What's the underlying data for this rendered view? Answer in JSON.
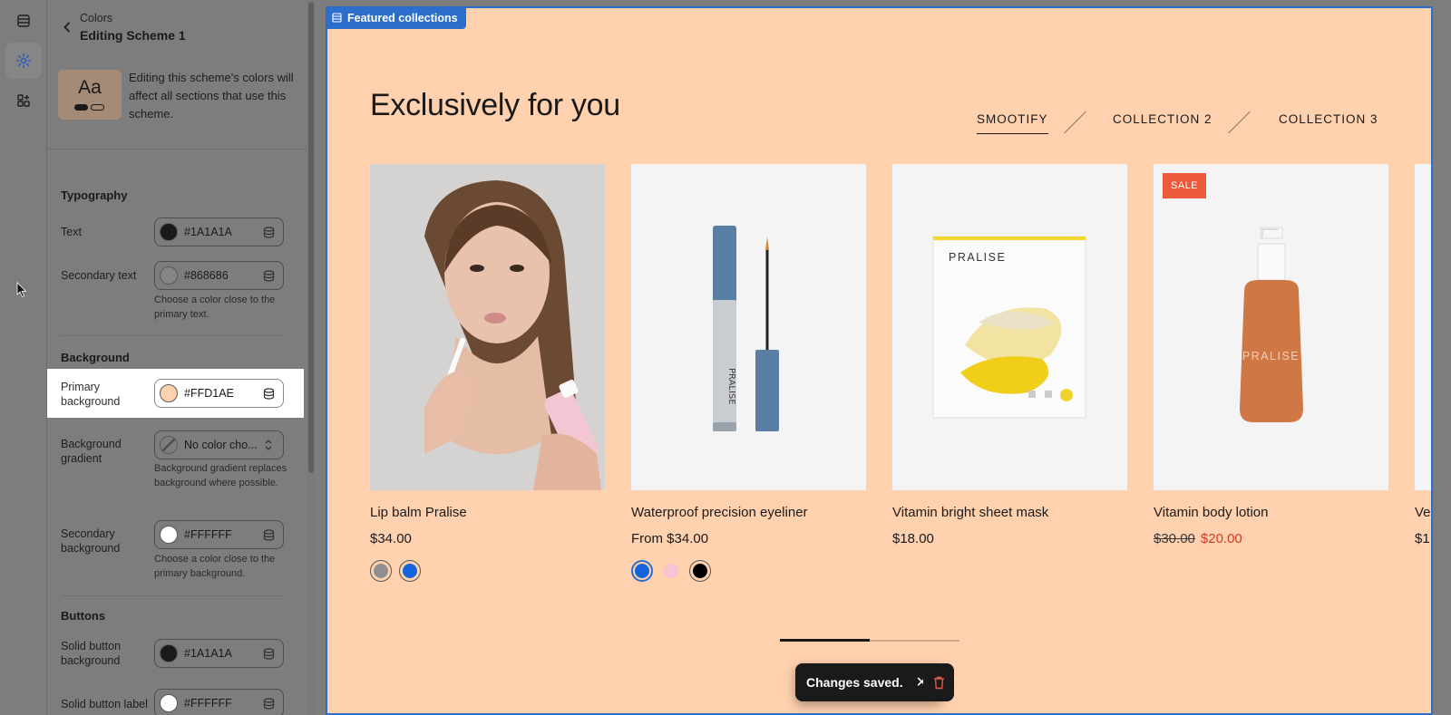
{
  "editor": {
    "header": {
      "kicker": "Colors",
      "title": "Editing Scheme 1"
    },
    "scheme_preview": {
      "glyph": "Aa",
      "note": "Editing this scheme's colors will affect all sections that use this scheme."
    },
    "typography": {
      "heading": "Typography",
      "text": {
        "label": "Text",
        "value": "#1A1A1A",
        "color": "#1A1A1A"
      },
      "secondary_text": {
        "label": "Secondary text",
        "value": "#868686",
        "color": "#868686",
        "help": "Choose a color close to the primary text."
      }
    },
    "background": {
      "heading": "Background",
      "primary": {
        "label": "Primary background",
        "value": "#FFD1AE",
        "color": "#FFD1AE"
      },
      "gradient": {
        "label": "Background gradient",
        "value": "No color cho...",
        "help": "Background gradient replaces background where possible."
      },
      "secondary": {
        "label": "Secondary background",
        "value": "#FFFFFF",
        "color": "#FFFFFF",
        "help": "Choose a color close to the primary background."
      }
    },
    "buttons": {
      "heading": "Buttons",
      "solid_bg": {
        "label": "Solid button background",
        "value": "#1A1A1A",
        "color": "#1A1A1A"
      },
      "solid_label": {
        "label": "Solid button label",
        "value": "#FFFFFF",
        "color": "#FFFFFF"
      }
    }
  },
  "preview": {
    "section_tag": "Featured collections",
    "heading": "Exclusively for you",
    "tabs": [
      "SMOOTIFY",
      "COLLECTION 2",
      "COLLECTION 3"
    ],
    "products": [
      {
        "name": "Lip balm Pralise",
        "price": "$34.00",
        "options": [
          "#8f8f8f",
          "#1463dd"
        ]
      },
      {
        "name": "Waterproof precision eyeliner",
        "price": "From $34.00",
        "options": [
          "#1463dd",
          "#f7c4d6",
          "#000000"
        ]
      },
      {
        "name": "Vitamin bright sheet mask",
        "price": "$18.00",
        "brand": "PRALISE"
      },
      {
        "name": "Vitamin body lotion",
        "old_price": "$30.00",
        "price": "$20.00",
        "badge": "SALE",
        "brand": "PRALISE"
      },
      {
        "name": "Ve",
        "price": "$1"
      }
    ],
    "carousel_progress": 0.5,
    "toast": "Changes saved."
  }
}
